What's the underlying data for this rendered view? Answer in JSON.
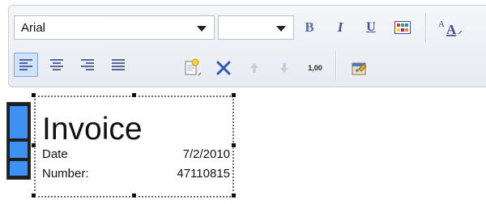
{
  "toolbar": {
    "font_family_value": "Arial",
    "font_size_value": "",
    "bold_label": "B",
    "italic_label": "I",
    "underline_label": "U",
    "number_format_label": "1,00",
    "icons": {
      "font_color": "a-font-icon",
      "align_left": "align-left-icon",
      "align_center": "align-center-icon",
      "align_right": "align-right-icon",
      "justify": "justify-icon",
      "new_item": "new-item-icon",
      "delete": "delete-x-icon",
      "move_up": "arrow-up-icon",
      "move_down": "arrow-down-icon",
      "properties": "properties-icon",
      "color_grid": "color-grid-icon"
    }
  },
  "invoice": {
    "title": "Invoice",
    "lines": [
      {
        "label": "Date",
        "value": "7/2/2010"
      },
      {
        "label": "Number:",
        "value": "47110815"
      }
    ]
  },
  "colors": {
    "accent_blue": "#3c91f2",
    "toolbar_bg": "#eef1f5",
    "active_button": "#cfe3fb"
  }
}
